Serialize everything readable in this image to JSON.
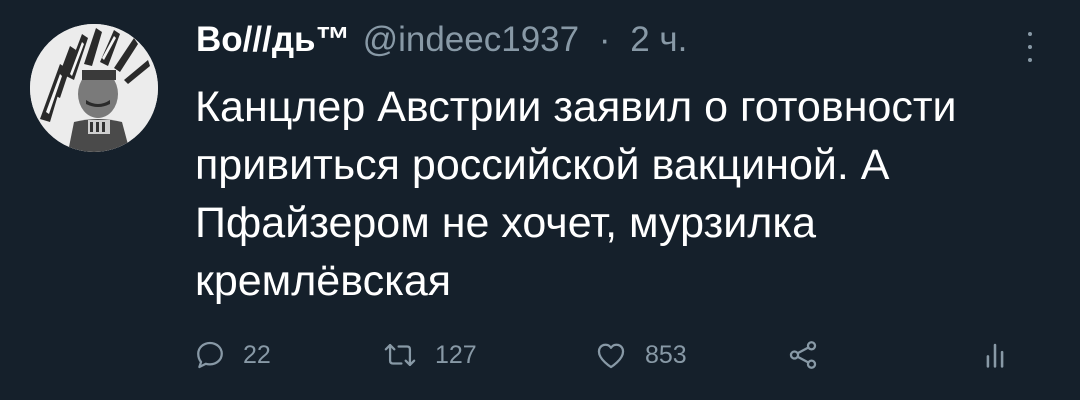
{
  "tweet": {
    "author_name": "Во///дь™",
    "handle": "@indeec1937",
    "separator": "·",
    "time": "2 ч.",
    "text": "Канцлер Австрии заявил о готовности\nпривиться российской вакциной. А\nПфайзером не хочет, мурзилка\nкремлёвская",
    "avatar_icon": "avatar-photo-headdress"
  },
  "actions": {
    "reply_count": "22",
    "retweet_count": "127",
    "like_count": "853",
    "icons": [
      "reply-icon",
      "retweet-icon",
      "like-icon",
      "share-icon",
      "analytics-icon"
    ]
  },
  "colors": {
    "background": "#15202b",
    "primary_text": "#ffffff",
    "secondary_text": "#8899a6"
  }
}
